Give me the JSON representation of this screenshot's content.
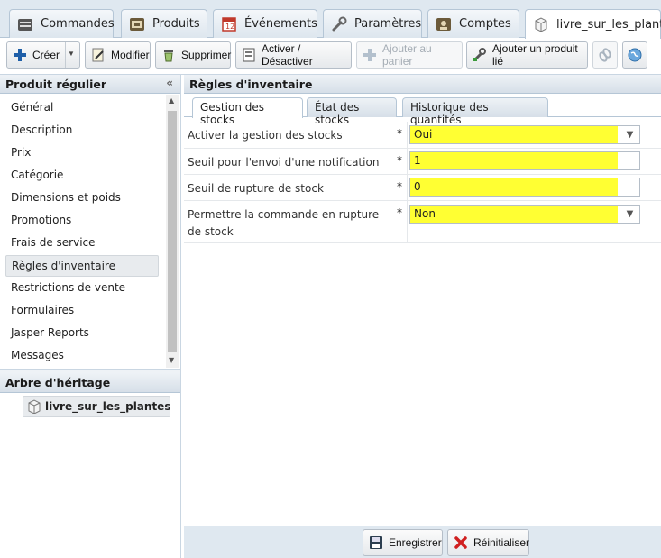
{
  "tabs": [
    {
      "label": "Commandes",
      "icon": "orders-icon"
    },
    {
      "label": "Produits",
      "icon": "products-icon"
    },
    {
      "label": "Événements",
      "icon": "calendar-icon"
    },
    {
      "label": "Paramètres",
      "icon": "wrench-icon"
    },
    {
      "label": "Comptes",
      "icon": "accounts-icon"
    },
    {
      "label": "livre_sur_les_plantes",
      "icon": "product-box-icon",
      "active": true
    }
  ],
  "toolbar": {
    "create": "Créer",
    "edit": "Modifier",
    "delete": "Supprimer",
    "toggle": "Activer / Désactiver",
    "add_cart": "Ajouter au panier",
    "add_linked": "Ajouter un produit lié"
  },
  "left": {
    "title": "Produit régulier",
    "items": [
      "Général",
      "Description",
      "Prix",
      "Catégorie",
      "Dimensions et poids",
      "Promotions",
      "Frais de service",
      "Règles d'inventaire",
      "Restrictions de vente",
      "Formulaires",
      "Jasper Reports",
      "Messages"
    ],
    "selected": "Règles d'inventaire",
    "tree_title": "Arbre d'héritage",
    "tree_node": "livre_sur_les_plantes"
  },
  "right": {
    "title": "Règles d'inventaire",
    "subtabs": [
      "Gestion des stocks",
      "État des stocks",
      "Historique des quantités"
    ],
    "rows": [
      {
        "label": "Activer la gestion des stocks",
        "required": "*",
        "value": "Oui",
        "type": "select"
      },
      {
        "label": "Seuil pour l'envoi d'une notification",
        "required": "*",
        "value": "1",
        "type": "text"
      },
      {
        "label": "Seuil de rupture de stock",
        "required": "*",
        "value": "0",
        "type": "text"
      },
      {
        "label": "Permettre la commande en rupture de stock",
        "required": "*",
        "value": "Non",
        "type": "select"
      }
    ],
    "save": "Enregistrer",
    "reset": "Réinitialiser"
  },
  "colors": {
    "highlight": "#ffff33",
    "panel": "#dfe8f0",
    "border": "#b5c6d6"
  }
}
